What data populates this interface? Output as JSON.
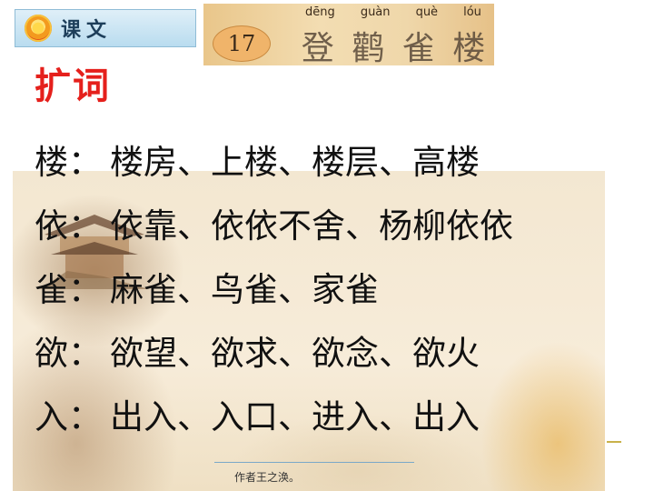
{
  "header": {
    "tab_label": "课文",
    "tab_icon": "sunflower-icon",
    "lesson_number": "17",
    "lesson_title_pinyin": [
      "dēng",
      "guàn",
      "què",
      "lóu"
    ],
    "lesson_title_chars": [
      "登",
      "鹳",
      "雀",
      "楼"
    ]
  },
  "section": {
    "title": "扩词"
  },
  "rows": [
    {
      "char": "楼",
      "colon": "：",
      "words": "楼房、上楼、楼层、高楼"
    },
    {
      "char": "依",
      "colon": "：",
      "words": "依靠、依依不舍、杨柳依依"
    },
    {
      "char": "雀",
      "colon": "：",
      "words": "麻雀、鸟雀、家雀"
    },
    {
      "char": "欲",
      "colon": "：",
      "words": "欲望、欲求、欲念、欲火"
    },
    {
      "char": "入",
      "colon": "：",
      "words": "出入、入口、进入、出入"
    }
  ],
  "caption": "作者王之涣。",
  "colors": {
    "title_red": "#e5201c",
    "text": "#111111",
    "tab_blue": "#b9dcef"
  }
}
